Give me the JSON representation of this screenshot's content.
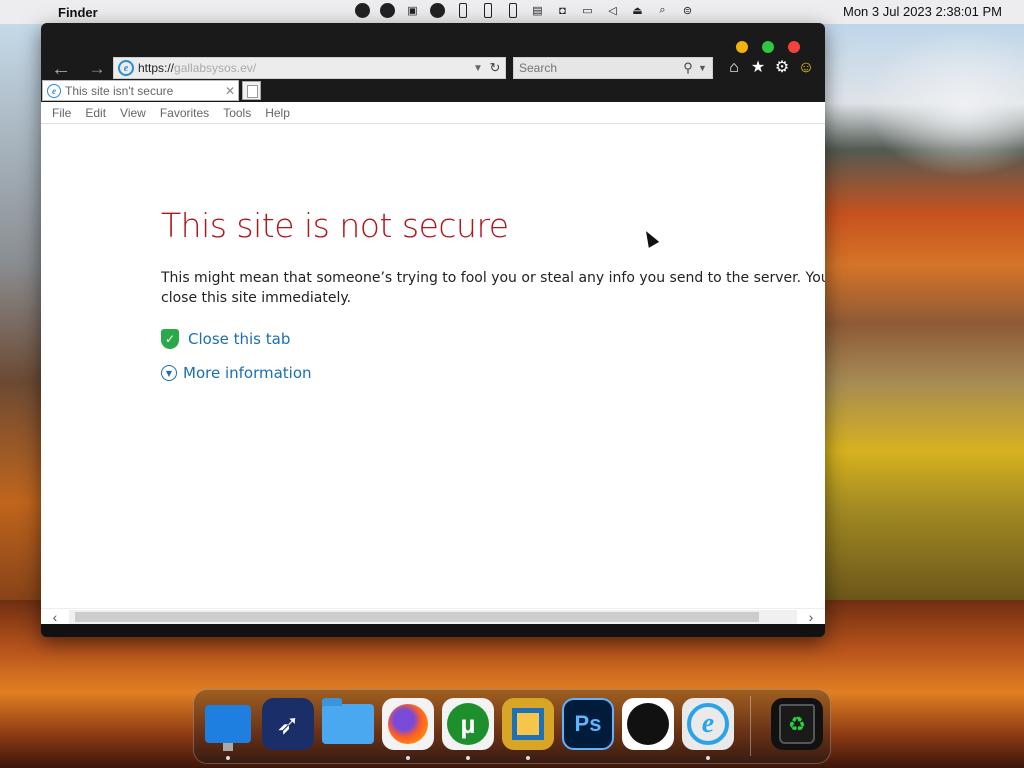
{
  "menubar": {
    "app_name": "Finder",
    "clock": "Mon 3 Jul 2023 2:38:01 PM"
  },
  "browser": {
    "address": {
      "scheme": "https://",
      "host": "gallabsysos.ev",
      "path": "/"
    },
    "search_placeholder": "Search",
    "tab_label": "This site isn't secure",
    "menu": [
      "File",
      "Edit",
      "View",
      "Favorites",
      "Tools",
      "Help"
    ]
  },
  "page": {
    "title": "This site is not secure",
    "description_line1": "This might mean that someone’s trying to fool you or steal any info you send to the server. You shou",
    "description_line2": "close this site immediately.",
    "close_tab": "Close this tab",
    "more_info": "More information"
  },
  "dock": {
    "apps": [
      "finder-screen",
      "launchpad",
      "files",
      "firefox",
      "utorrent",
      "vmware",
      "photoshop",
      "apple",
      "internet-explorer",
      "trash"
    ],
    "photoshop_label": "Ps"
  },
  "colors": {
    "error_title": "#b0161c",
    "link": "#1a6fb0"
  }
}
